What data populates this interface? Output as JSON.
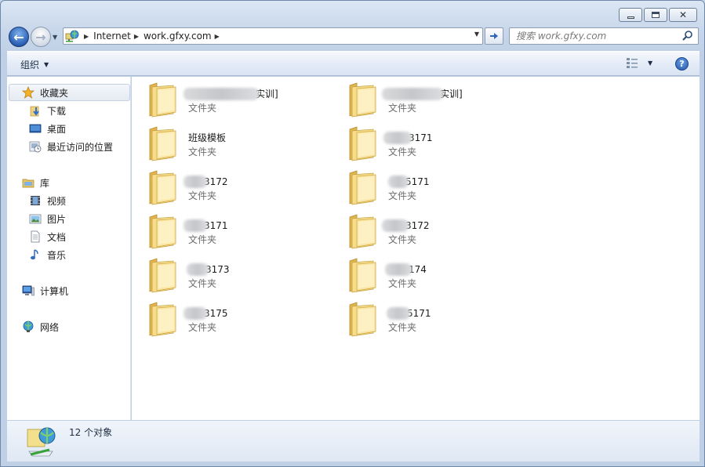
{
  "window": {
    "caption_buttons": [
      "minimize",
      "maximize",
      "close"
    ]
  },
  "nav": {
    "back_icon": "back-arrow-icon",
    "forward_icon": "forward-arrow-icon"
  },
  "address": {
    "breadcrumbs": [
      "Internet",
      "work.gfxy.com"
    ]
  },
  "search": {
    "placeholder": "搜索 work.gfxy.com"
  },
  "toolbar": {
    "organize_label": "组织"
  },
  "sidebar": {
    "favorites": {
      "label": "收藏夹",
      "items": [
        "下载",
        "桌面",
        "最近访问的位置"
      ]
    },
    "libraries": {
      "label": "库",
      "items": [
        "视频",
        "图片",
        "文档",
        "音乐"
      ]
    },
    "computer": "计算机",
    "network": "网络"
  },
  "folders": [
    {
      "name": "实训]",
      "type": "文件夹"
    },
    {
      "name": "实训]",
      "type": "文件夹"
    },
    {
      "name": "班级模板",
      "type": "文件夹"
    },
    {
      "name": "3171",
      "type": "文件夹"
    },
    {
      "name": "3172",
      "type": "文件夹"
    },
    {
      "name": "5171",
      "type": "文件夹"
    },
    {
      "name": "3171",
      "type": "文件夹"
    },
    {
      "name": "3172",
      "type": "文件夹"
    },
    {
      "name": "3173",
      "type": "文件夹"
    },
    {
      "name": "174",
      "type": "文件夹"
    },
    {
      "name": "3175",
      "type": "文件夹"
    },
    {
      "name": "5171",
      "type": "文件夹"
    }
  ],
  "details": {
    "count_text": "12 个对象"
  },
  "colors": {
    "folder_body": "#f3d57f",
    "folder_back": "#e2b74f",
    "selection_border": "#c5d1e0",
    "window_frame": "#c7d6ea"
  }
}
